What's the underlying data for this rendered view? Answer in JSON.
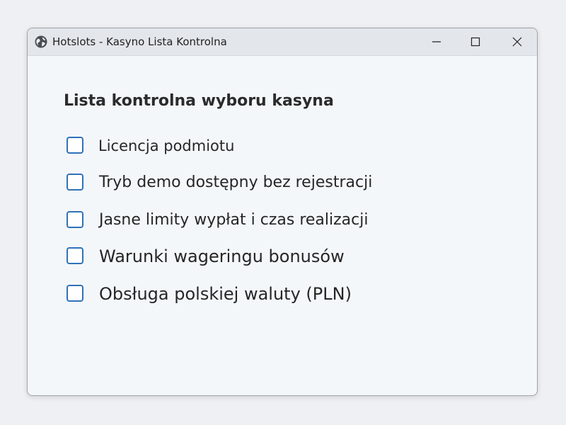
{
  "window": {
    "title": "Hotslots - Kasyno Lista Kontrolna",
    "icon": "globe-icon",
    "controls": {
      "minimize_icon": "minimize-icon",
      "maximize_icon": "maximize-icon",
      "close_icon": "close-icon"
    }
  },
  "checklist": {
    "heading": "Lista kontrolna wyboru kasyna",
    "items": [
      {
        "label": "Licencja podmiotu",
        "checked": false
      },
      {
        "label": "Tryb demo dostępny bez rejestracji",
        "checked": false
      },
      {
        "label": "Jasne limity wypłat i czas realizacji",
        "checked": false
      },
      {
        "label": "Warunki wageringu bonusów",
        "checked": false
      },
      {
        "label": "Obsługa polskiej waluty (PLN)",
        "checked": false
      }
    ]
  },
  "colors": {
    "accent": "#2f72b8",
    "titlebar": "#e3e6ea",
    "background": "#f4f7fa",
    "text": "#262626"
  }
}
